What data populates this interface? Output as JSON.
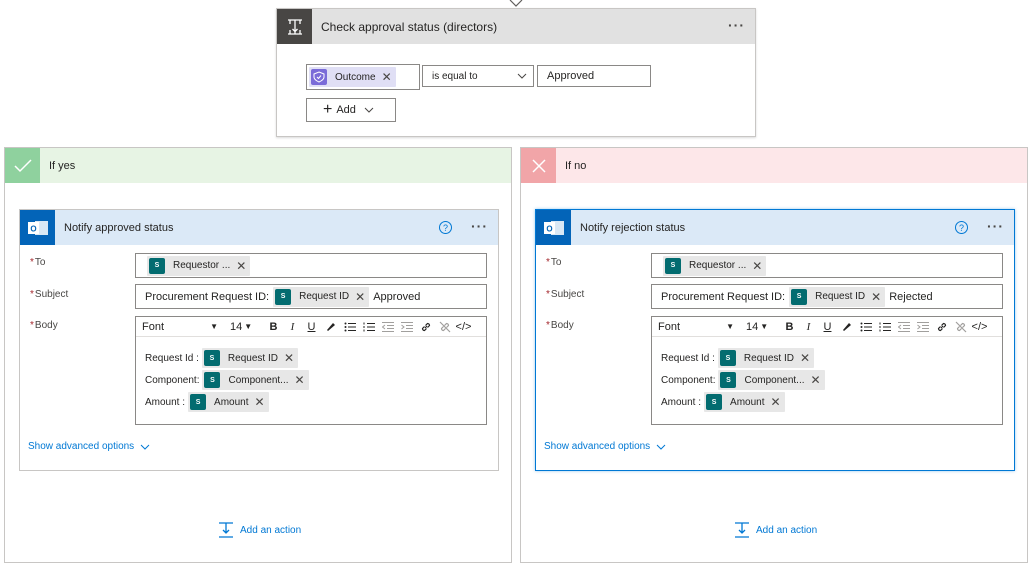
{
  "condition": {
    "title": "Check approval status (directors)",
    "left_token": "Outcome",
    "operator": "is equal to",
    "value": "Approved",
    "add_label": "Add"
  },
  "yes": {
    "label": "If yes",
    "action": {
      "title": "Notify approved status",
      "to_label": "To",
      "to_token": "Requestor ...",
      "subject_label": "Subject",
      "subject_prefix": "Procurement Request ID:",
      "subject_token": "Request ID",
      "subject_suffix": "Approved",
      "body_label": "Body",
      "font": "Font",
      "font_size": "14",
      "body_lines": [
        {
          "label": "Request Id :",
          "token": "Request ID"
        },
        {
          "label": "Component:",
          "token": "Component..."
        },
        {
          "label": "Amount :",
          "token": "Amount"
        }
      ],
      "advanced": "Show advanced options"
    },
    "add_action": "Add an action"
  },
  "no": {
    "label": "If no",
    "action": {
      "title": "Notify rejection status",
      "to_label": "To",
      "to_token": "Requestor ...",
      "subject_label": "Subject",
      "subject_prefix": "Procurement Request ID:",
      "subject_token": "Request ID",
      "subject_suffix": "Rejected",
      "body_label": "Body",
      "font": "Font",
      "font_size": "14",
      "body_lines": [
        {
          "label": "Request Id :",
          "token": "Request ID"
        },
        {
          "label": "Component:",
          "token": "Component..."
        },
        {
          "label": "Amount :",
          "token": "Amount"
        }
      ],
      "advanced": "Show advanced options"
    },
    "add_action": "Add an action"
  },
  "icons": {
    "sharepoint": "S"
  },
  "colors": {
    "yes_head": "#e7f4e4",
    "yes_icon": "#8fd19e",
    "no_head": "#fde7e9",
    "no_icon": "#f1a5a8",
    "outlook": "#0364b8",
    "link": "#0078d4"
  }
}
